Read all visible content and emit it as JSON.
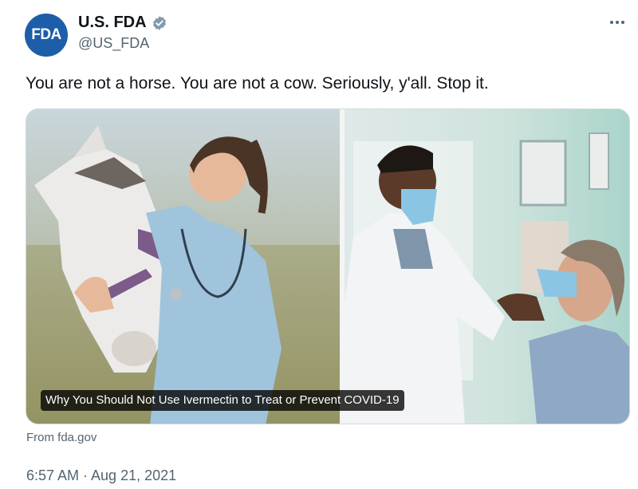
{
  "author": {
    "avatar_text": "FDA",
    "display_name": "U.S. FDA",
    "handle": "@US_FDA",
    "verified": true,
    "avatar_color": "#1d5ea8"
  },
  "tweet": {
    "text": "You are not a horse. You are not a cow. Seriously, y'all. Stop it.",
    "timestamp": "6:57 AM · Aug 21, 2021"
  },
  "link_card": {
    "caption": "Why You Should Not Use Ivermectin to Treat or Prevent COVID-19",
    "source": "From fda.gov"
  },
  "icons": {
    "verified": "verified-badge-icon",
    "more": "more-options-icon"
  },
  "colors": {
    "text_primary": "#0f1419",
    "text_secondary": "#536471",
    "verified_badge": "#829aab"
  }
}
